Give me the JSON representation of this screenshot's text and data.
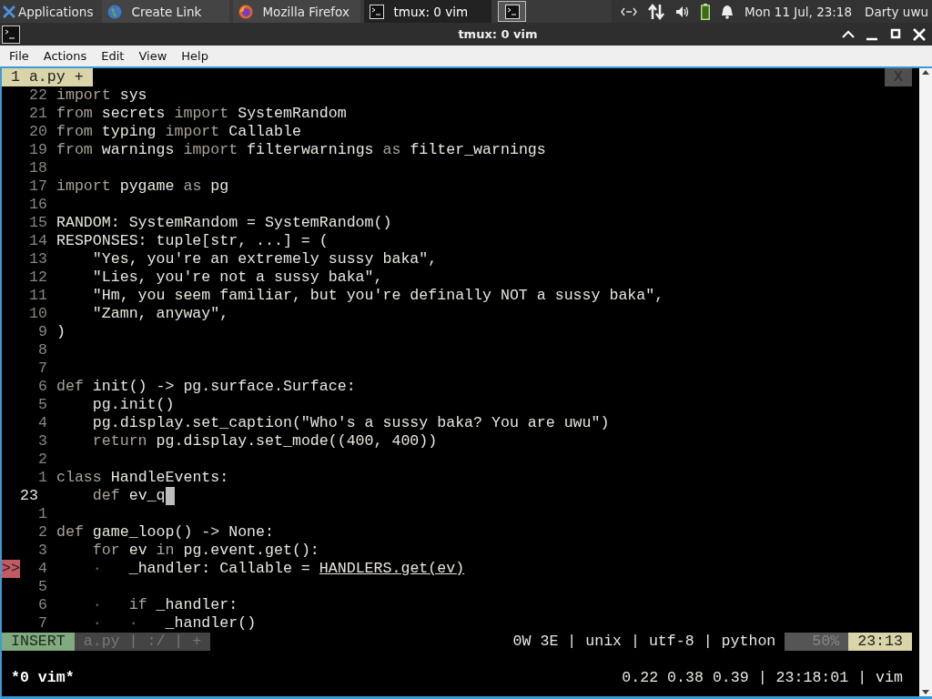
{
  "taskbar": {
    "menu": {
      "label": "Applications"
    },
    "tasks": [
      {
        "label": "Create Link",
        "kind": "globe",
        "selected": false
      },
      {
        "label": "Mozilla Firefox",
        "kind": "browser",
        "selected": false
      },
      {
        "label": "tmux: 0 vim",
        "kind": "terminal",
        "selected": true
      }
    ],
    "clock": "Mon 11 Jul, 23:18",
    "user": "Darty uwu"
  },
  "window": {
    "title": "tmux: 0 vim"
  },
  "menu": [
    "File",
    "Actions",
    "Edit",
    "View",
    "Help"
  ],
  "editor": {
    "tabline": {
      "buffer": "1 a.py +",
      "close": "X"
    },
    "lines": [
      {
        "number": "22",
        "current": false,
        "cursor": false,
        "segments": [
          {
            "text": "import",
            "kind": "keyword"
          },
          {
            "text": " sys",
            "kind": "plain"
          }
        ]
      },
      {
        "number": "21",
        "current": false,
        "cursor": false,
        "segments": [
          {
            "text": "from",
            "kind": "keyword"
          },
          {
            "text": " secrets ",
            "kind": "plain"
          },
          {
            "text": "import",
            "kind": "keyword"
          },
          {
            "text": " SystemRandom",
            "kind": "plain"
          }
        ]
      },
      {
        "number": "20",
        "current": false,
        "cursor": false,
        "segments": [
          {
            "text": "from",
            "kind": "keyword"
          },
          {
            "text": " typing ",
            "kind": "plain"
          },
          {
            "text": "import",
            "kind": "keyword"
          },
          {
            "text": " Callable",
            "kind": "plain"
          }
        ]
      },
      {
        "number": "19",
        "current": false,
        "cursor": false,
        "segments": [
          {
            "text": "from",
            "kind": "keyword"
          },
          {
            "text": " warnings ",
            "kind": "plain"
          },
          {
            "text": "import",
            "kind": "keyword"
          },
          {
            "text": " filterwarnings ",
            "kind": "plain"
          },
          {
            "text": "as",
            "kind": "keyword"
          },
          {
            "text": " filter_warnings",
            "kind": "plain"
          }
        ]
      },
      {
        "number": "18",
        "current": false,
        "cursor": false
      },
      {
        "number": "17",
        "current": false,
        "cursor": false,
        "segments": [
          {
            "text": "import",
            "kind": "keyword"
          },
          {
            "text": " pygame ",
            "kind": "plain"
          },
          {
            "text": "as",
            "kind": "keyword"
          },
          {
            "text": " pg",
            "kind": "plain"
          }
        ]
      },
      {
        "number": "16",
        "current": false,
        "cursor": false
      },
      {
        "number": "15",
        "current": false,
        "cursor": false,
        "segments": [
          {
            "text": "RANDOM: SystemRandom = SystemRandom()",
            "kind": "plain"
          }
        ]
      },
      {
        "number": "14",
        "current": false,
        "cursor": false,
        "segments": [
          {
            "text": "RESPONSES: tuple[str, ...] = (",
            "kind": "plain"
          }
        ]
      },
      {
        "number": "13",
        "current": false,
        "cursor": false,
        "segments": [
          {
            "text": "    \"Yes, you're an extremely sussy baka\",",
            "kind": "plain"
          }
        ]
      },
      {
        "number": "12",
        "current": false,
        "cursor": false,
        "segments": [
          {
            "text": "    \"Lies, you're not a sussy baka\",",
            "kind": "plain"
          }
        ]
      },
      {
        "number": "11",
        "current": false,
        "cursor": false,
        "segments": [
          {
            "text": "    \"Hm, you seem familiar, but you're definally NOT a sussy baka\",",
            "kind": "plain"
          }
        ]
      },
      {
        "number": "10",
        "current": false,
        "cursor": false,
        "segments": [
          {
            "text": "    \"Zamn, anyway\",",
            "kind": "plain"
          }
        ]
      },
      {
        "number": "9",
        "current": false,
        "cursor": false,
        "segments": [
          {
            "text": ")",
            "kind": "plain"
          }
        ]
      },
      {
        "number": "8",
        "current": false,
        "cursor": false
      },
      {
        "number": "7",
        "current": false,
        "cursor": false
      },
      {
        "number": "6",
        "current": false,
        "cursor": false,
        "segments": [
          {
            "text": "def",
            "kind": "keyword"
          },
          {
            "text": " init() -> pg.surface.Surface:",
            "kind": "plain"
          }
        ]
      },
      {
        "number": "5",
        "current": false,
        "cursor": false,
        "segments": [
          {
            "text": "    pg.init()",
            "kind": "plain"
          }
        ]
      },
      {
        "number": "4",
        "current": false,
        "cursor": false,
        "segments": [
          {
            "text": "    pg.display.set_caption(\"Who's a sussy baka? You are uwu\")",
            "kind": "plain"
          }
        ]
      },
      {
        "number": "3",
        "current": false,
        "cursor": false,
        "segments": [
          {
            "text": "    return",
            "kind": "keyword"
          },
          {
            "text": " pg.display.set_mode((400, 400))",
            "kind": "plain"
          }
        ]
      },
      {
        "number": "2",
        "current": false,
        "cursor": false
      },
      {
        "number": "1",
        "current": false,
        "cursor": false,
        "segments": [
          {
            "text": "class",
            "kind": "keyword"
          },
          {
            "text": " HandleEvents:",
            "kind": "plain"
          }
        ]
      },
      {
        "number": "23",
        "current": true,
        "cursor": true,
        "segments": [
          {
            "text": "    def",
            "kind": "keyword"
          },
          {
            "text": " ev_q",
            "kind": "plain"
          }
        ]
      },
      {
        "number": "1",
        "current": false,
        "cursor": false
      },
      {
        "number": "2",
        "current": false,
        "cursor": false,
        "segments": [
          {
            "text": "def",
            "kind": "keyword"
          },
          {
            "text": " game_loop() -> None:",
            "kind": "plain"
          }
        ]
      },
      {
        "number": "3",
        "current": false,
        "cursor": false,
        "segments": [
          {
            "text": "    for",
            "kind": "keyword"
          },
          {
            "text": " ev ",
            "kind": "plain"
          },
          {
            "text": "in",
            "kind": "keyword"
          },
          {
            "text": " pg.event.get():",
            "kind": "plain"
          }
        ]
      },
      {
        "number": "4",
        "current": false,
        "cursor": false,
        "sign": ">>",
        "segments": [
          {
            "text": "    ·",
            "kind": "whitespace"
          },
          {
            "text": "   _handler: Callable = ",
            "kind": "plain"
          },
          {
            "text": "HANDLERS.get(ev)",
            "kind": "link"
          }
        ]
      },
      {
        "number": "5",
        "current": false,
        "cursor": false
      },
      {
        "number": "6",
        "current": false,
        "cursor": false,
        "segments": [
          {
            "text": "    ·",
            "kind": "whitespace"
          },
          {
            "text": "   if",
            "kind": "keyword"
          },
          {
            "text": " _handler:",
            "kind": "plain"
          }
        ]
      },
      {
        "number": "7",
        "current": false,
        "cursor": false,
        "segments": [
          {
            "text": "    ·",
            "kind": "whitespace"
          },
          {
            "text": "   ·",
            "kind": "whitespace"
          },
          {
            "text": "   _handler()",
            "kind": "plain"
          }
        ]
      }
    ],
    "statusline": {
      "mode": "INSERT",
      "file": "a.py | :/ | +",
      "info": "0W 3E | unix | utf-8 | python",
      "percent": "50%",
      "position": "23:13"
    }
  },
  "tmux": {
    "window": "*0 vim*",
    "status": "0.22 0.38 0.39 | 23:18:01 | vim"
  }
}
